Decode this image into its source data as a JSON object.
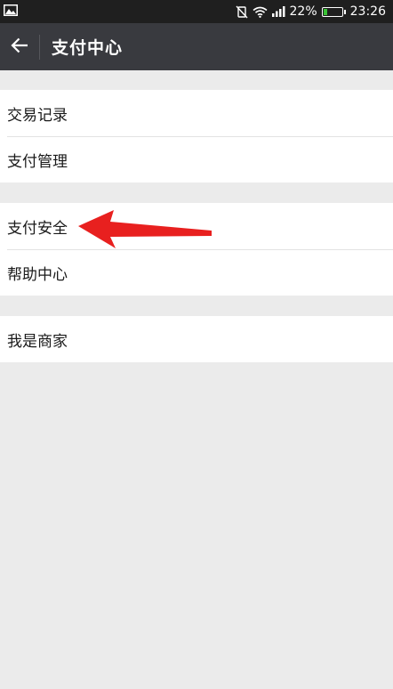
{
  "status_bar": {
    "image_icon": "image-icon",
    "battery_percent": "22%",
    "battery_level": 0.22,
    "time": "23:26",
    "icons": [
      "vibrate-off-icon",
      "wifi-icon",
      "signal-icon",
      "battery-icon"
    ]
  },
  "header": {
    "title": "支付中心",
    "back_icon": "arrow-left-icon"
  },
  "groups": [
    {
      "items": [
        {
          "label": "交易记录"
        },
        {
          "label": "支付管理"
        }
      ]
    },
    {
      "items": [
        {
          "label": "支付安全"
        },
        {
          "label": "帮助中心"
        }
      ]
    },
    {
      "items": [
        {
          "label": "我是商家"
        }
      ]
    }
  ],
  "annotation": {
    "type": "red-arrow",
    "points_to": "支付安全",
    "color": "#e8201f"
  },
  "colors": {
    "status_bar_bg": "#1f1f1f",
    "app_bar_bg": "#393a3f",
    "page_bg": "#ebebeb",
    "cell_bg": "#ffffff",
    "battery_fill": "#39c235"
  }
}
